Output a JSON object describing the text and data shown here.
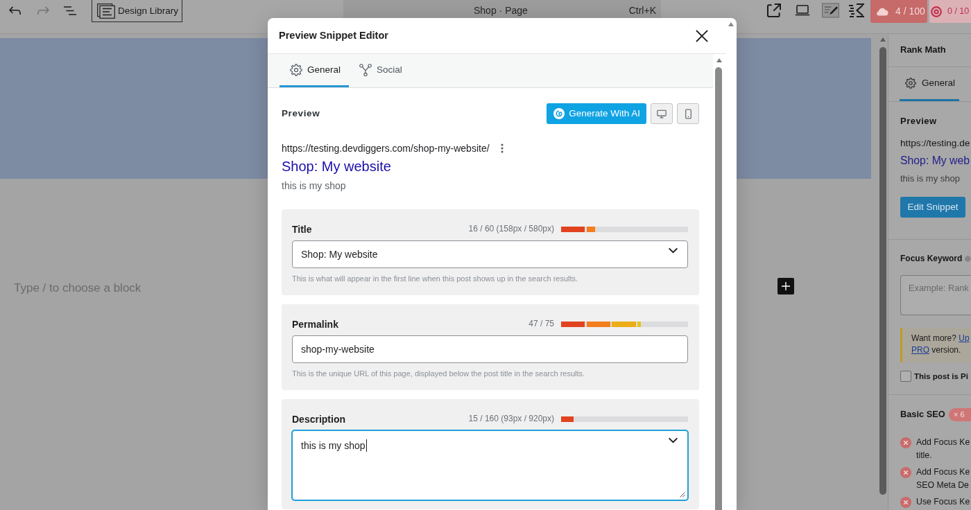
{
  "toolbar": {
    "library_button": "Design Library",
    "command_bar": {
      "title": "Shop · Page",
      "shortcut": "Ctrl+K"
    },
    "scores": [
      {
        "kind": "solid",
        "text": "4 / 100"
      },
      {
        "kind": "soft",
        "text": "0 / 10"
      }
    ]
  },
  "editor": {
    "placeholder": "Type / to choose a block"
  },
  "sidebar": {
    "title": "Rank Math",
    "tabs": [
      {
        "label": "General",
        "selected": true
      }
    ],
    "preview": {
      "heading": "Preview",
      "url": "https://testing.de",
      "title": "Shop: My web",
      "description": "this is my shop",
      "button": "Edit Snippet"
    },
    "focus_keyword": {
      "label": "Focus Keyword",
      "placeholder": "Example: Rank"
    },
    "notice": {
      "lines": [
        [
          {
            "kind": "text",
            "text": "Want more? "
          },
          {
            "kind": "link",
            "text": "Up"
          }
        ],
        [
          {
            "kind": "link",
            "text": "PRO"
          },
          {
            "kind": "text",
            "text": " version."
          }
        ]
      ]
    },
    "pillar_checkbox": {
      "label": "This post is Pi",
      "checked": false
    },
    "basic_seo": {
      "heading": "Basic SEO",
      "badge": "× 6",
      "items": [
        {
          "lines": [
            "Add Focus Ke",
            "title."
          ]
        },
        {
          "lines": [
            "Add Focus Ke",
            "SEO Meta De"
          ]
        },
        {
          "lines": [
            "Use Focus Ke"
          ]
        }
      ]
    }
  },
  "dialog": {
    "title": "Preview Snippet Editor",
    "tabs": [
      {
        "label": "General",
        "selected": true
      },
      {
        "label": "Social",
        "selected": false
      }
    ],
    "preview": {
      "heading": "Preview",
      "ai_button": "Generate With AI",
      "url": "https://testing.devdiggers.com/shop-my-website/",
      "title": "Shop: My website",
      "description": "this is my shop"
    },
    "fields": [
      {
        "kind": "select",
        "label": "Title",
        "counter": "16 / 60 (158px / 580px)",
        "level": 0.27,
        "value": "Shop: My website",
        "focused": false,
        "help": "This is what will appear in the first line when this post shows up in the search results."
      },
      {
        "kind": "text",
        "label": "Permalink",
        "counter": "47 / 75",
        "level": 0.63,
        "value": "shop-my-website",
        "focused": false,
        "help": "This is the unique URL of this page, displayed below the post title in the search results."
      },
      {
        "kind": "textarea",
        "label": "Description",
        "counter": "15 / 160 (93px / 920px)",
        "level": 0.1,
        "value": "this is my shop",
        "focused": true
      }
    ]
  }
}
